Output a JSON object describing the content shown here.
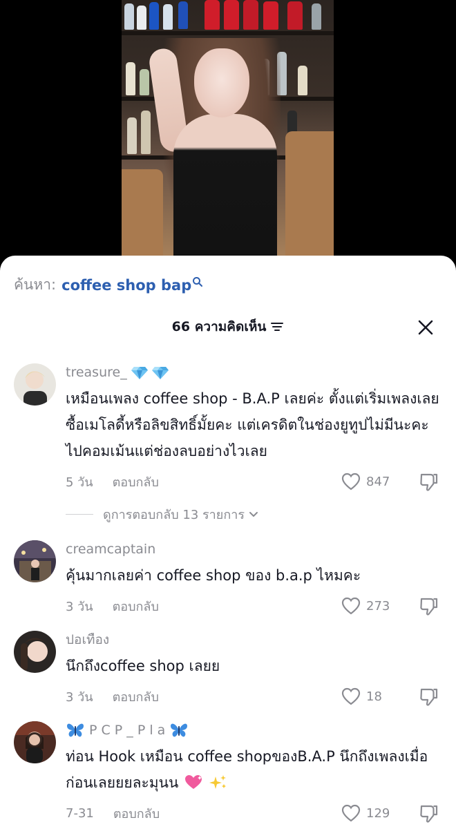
{
  "search": {
    "prefix": "ค้นหา:",
    "term": "coffee shop bap"
  },
  "header": {
    "count_label": "66 ความคิดเห็น"
  },
  "comments": [
    {
      "username": "treasure_",
      "username_emoji": "gem-stone-emoji x2",
      "text": "เหมือนเพลง coffee shop - B.A.P เลยค่ะ ตั้งแต่เริ่มเพลงเลย ซื้อเมโลดี้หรือลิขสิทธิ์มั้ยคะ แต่เครดิตในช่องยูทูปไม่มีนะคะ ไปคอมเม้นแต่ช่องลบอย่างไวเลย",
      "time": "5 วัน",
      "reply": "ตอบกลับ",
      "likes": "847",
      "view_replies": "ดูการตอบกลับ 13 รายการ"
    },
    {
      "username": "creamcaptain",
      "text": "คุ้นมากเลยค่า coffee shop ของ b.a.p ไหมคะ",
      "time": "3 วัน",
      "reply": "ตอบกลับ",
      "likes": "273"
    },
    {
      "username": "ปอเทือง",
      "text": "นึกถึงcoffee shop เลยย",
      "time": "3 วัน",
      "reply": "ตอบกลับ",
      "likes": "18"
    },
    {
      "username": "P C P _ P l a",
      "username_emoji": "blue-butterfly-emoji x2",
      "text": "ท่อน Hook เหมือน coffee shopของB.A.P นึกถึงเพลงเมื่อก่อนเลยยยละมุนน",
      "text_emoji": "sparkling-heart, sparkles",
      "time": "7-31",
      "reply": "ตอบกลับ",
      "likes": "129"
    }
  ],
  "colors": {
    "search_term": "#2d5fb0",
    "muted_text": "#8a8b91",
    "primary_text": "#161823",
    "sheet_bg": "#ffffff"
  }
}
